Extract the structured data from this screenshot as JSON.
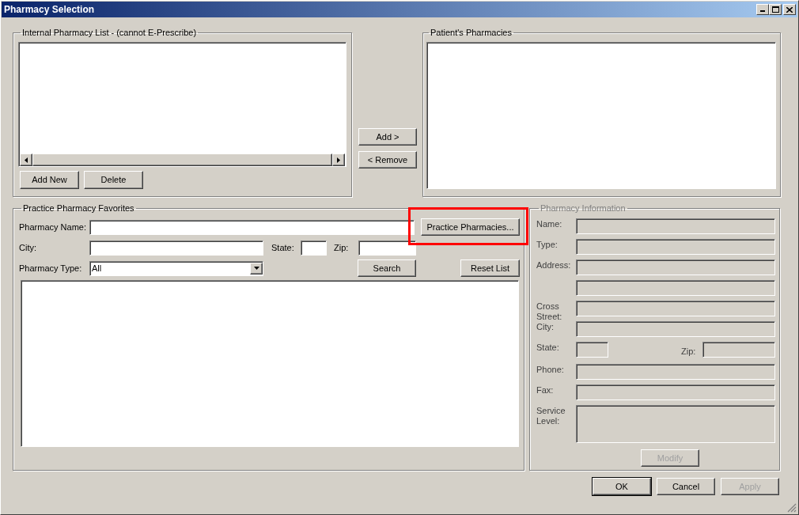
{
  "window": {
    "title": "Pharmacy Selection"
  },
  "internal_list": {
    "title": "Internal Pharmacy List - (cannot E-Prescribe)",
    "buttons": [
      {
        "label": "Add New",
        "disabled": false
      },
      {
        "label": "Delete",
        "disabled": false
      }
    ]
  },
  "transfer_buttons": [
    {
      "label": "Add >",
      "disabled": false
    },
    {
      "label": "< Remove",
      "disabled": false
    }
  ],
  "patients_pharmacies": {
    "title": "Patient's Pharmacies"
  },
  "favorites": {
    "title": "Practice Pharmacy Favorites",
    "pharmacy_name_label": "Pharmacy Name:",
    "practice_pharmacies_button": {
      "label": "Practice Pharmacies...",
      "highlighted": true
    },
    "city_label": "City:",
    "state_label": "State:",
    "zip_label": "Zip:",
    "pharmacy_type_label": "Pharmacy Type:",
    "pharmacy_type_value": "All",
    "search_button": "Search",
    "reset_button": "Reset List"
  },
  "pharmacy_information": {
    "title": "Pharmacy Information",
    "disabled": true,
    "rows": [
      {
        "kind": "text",
        "label": "Name:"
      },
      {
        "kind": "text",
        "label": "Type:"
      },
      {
        "kind": "text",
        "label": "Address:"
      },
      {
        "kind": "text"
      },
      {
        "kind": "text",
        "label": "Cross Street:"
      },
      {
        "kind": "text",
        "label": "City:"
      },
      {
        "kind": "state_zip",
        "label": "State:",
        "zip_label": "Zip:"
      },
      {
        "kind": "text",
        "label": "Phone:"
      },
      {
        "kind": "text",
        "label": "Fax:"
      },
      {
        "kind": "multiline",
        "label": "Service Level:"
      }
    ],
    "modify_button": {
      "label": "Modify",
      "disabled": true
    }
  },
  "dialog_buttons": [
    {
      "label": "OK",
      "default": true,
      "disabled": false
    },
    {
      "label": "Cancel",
      "default": false,
      "disabled": false
    },
    {
      "label": "Apply",
      "default": false,
      "disabled": true
    }
  ]
}
